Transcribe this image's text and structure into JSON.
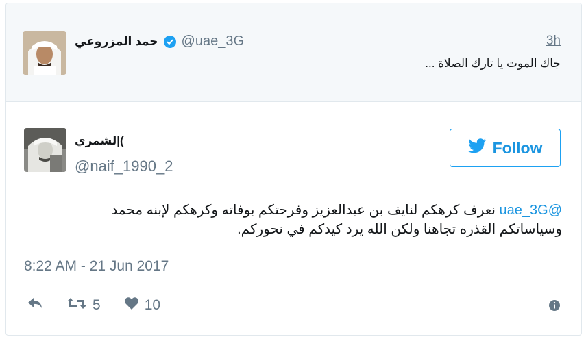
{
  "parent_tweet": {
    "author_name": "حمد المزروعي",
    "handle": "@uae_3G",
    "time": "3h",
    "text": "جاك الموت يا تارك الصلاة ..."
  },
  "tweet": {
    "author_name": "لشمري|(",
    "handle": "@naif_1990_2",
    "follow_label": "Follow",
    "mention": "@uae_3G",
    "text_line1": "نعرف كرهكم لنايف بن عبدالعزيز وفرحتكم بوفاته وكرهكم لإبنه محمد",
    "text_line2": "وسياساتكم القذره تجاهنا ولكن الله يرد كيدكم في نحوركم.",
    "timestamp": "8:22 AM - 21 Jun 2017",
    "retweet_count": "5",
    "like_count": "10"
  },
  "colors": {
    "accent": "#1da1f2",
    "link": "#1b95e0",
    "muted": "#657786",
    "parent_bg": "#f5f8fa"
  },
  "icons": [
    "verified-icon",
    "bird-icon",
    "reply-icon",
    "retweet-icon",
    "heart-icon",
    "info-icon"
  ]
}
